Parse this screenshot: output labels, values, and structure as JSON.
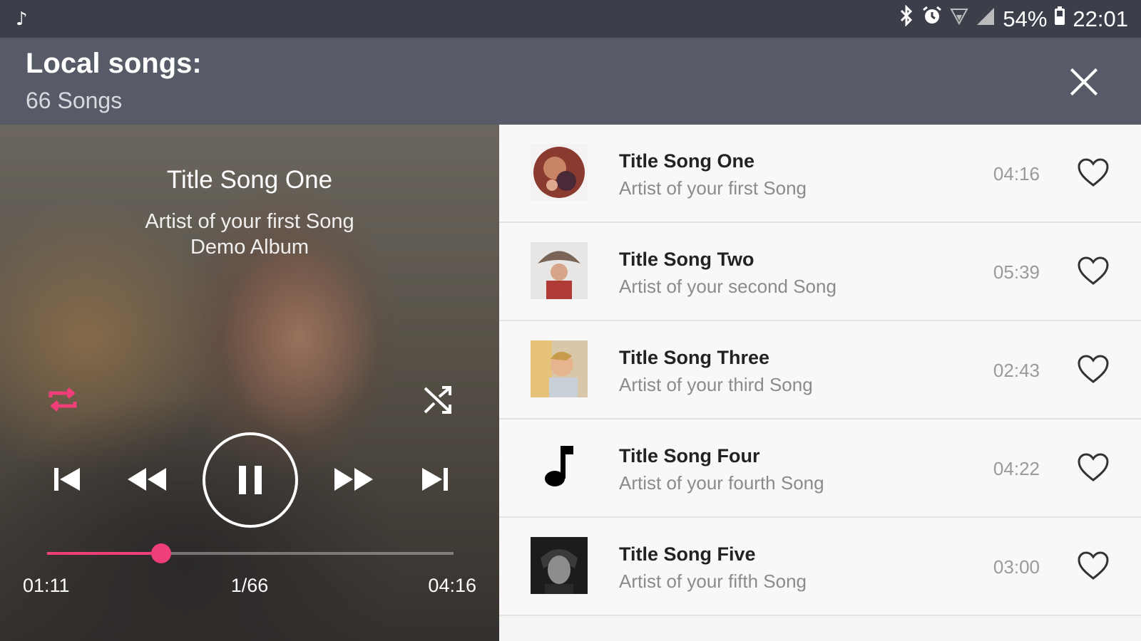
{
  "statusbar": {
    "notification_icon": "music-note-icon",
    "battery": "54%",
    "time": "22:01",
    "icons": [
      "bluetooth-icon",
      "alarm-icon",
      "wifi-icon",
      "signal-icon",
      "battery-icon"
    ]
  },
  "header": {
    "title": "Local songs:",
    "subtitle": "66 Songs",
    "close_icon": "close-icon"
  },
  "player": {
    "title": "Title Song One",
    "artist": "Artist of your first Song",
    "album": "Demo Album",
    "current_time": "01:11",
    "position": "1/66",
    "total_time": "04:16",
    "progress": 0.28,
    "accent_color": "#ef3e79"
  },
  "songs": [
    {
      "title": "Title Song One",
      "artist": "Artist of your first Song",
      "duration": "04:16",
      "thumb": "album-art"
    },
    {
      "title": "Title Song Two",
      "artist": "Artist of your second Song",
      "duration": "05:39",
      "thumb": "album-art"
    },
    {
      "title": "Title Song Three",
      "artist": "Artist of your third Song",
      "duration": "02:43",
      "thumb": "album-art"
    },
    {
      "title": "Title Song Four",
      "artist": "Artist of your fourth Song",
      "duration": "04:22",
      "thumb": "music-note-icon"
    },
    {
      "title": "Title Song Five",
      "artist": "Artist of your fifth Song",
      "duration": "03:00",
      "thumb": "album-art"
    }
  ]
}
